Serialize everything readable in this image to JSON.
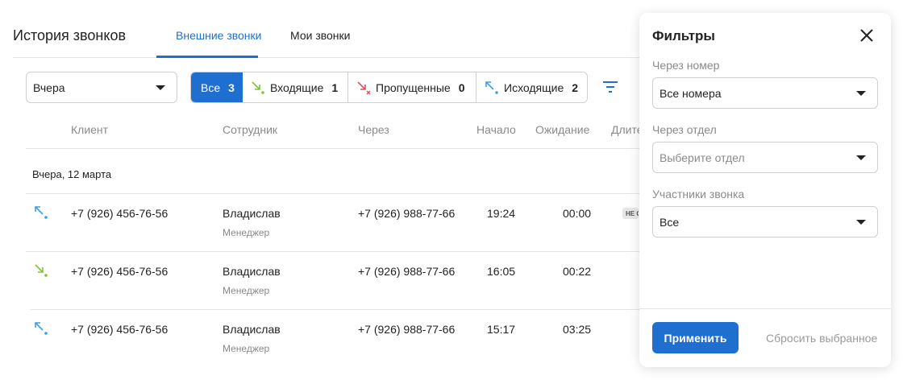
{
  "header": {
    "title": "История звонков",
    "tabs": [
      {
        "label": "Внешние звонки",
        "active": true
      },
      {
        "label": "Мои звонки",
        "active": false
      }
    ]
  },
  "toolbar": {
    "date_select": "Вчера",
    "segments": [
      {
        "label": "Все",
        "count": "3",
        "active": true,
        "icon": "none"
      },
      {
        "label": "Входящие",
        "count": "1",
        "active": false,
        "icon": "incoming-call-icon"
      },
      {
        "label": "Пропущенные",
        "count": "0",
        "active": false,
        "icon": "missed-call-icon"
      },
      {
        "label": "Исходящие",
        "count": "2",
        "active": false,
        "icon": "outgoing-call-icon"
      }
    ],
    "filter_icon": "filter-icon"
  },
  "table": {
    "columns": [
      "Клиент",
      "Сотрудник",
      "Через",
      "Начало",
      "Ожидание",
      "Длите"
    ],
    "group_label": "Вчера, 12 марта",
    "rows": [
      {
        "direction": "outgoing",
        "client": "+7 (926) 456-76-56",
        "employee": "Владислав",
        "role": "Менеджер",
        "via": "+7 (926) 988-77-66",
        "start": "19:24",
        "wait": "00:00",
        "badge": "НЕ О"
      },
      {
        "direction": "incoming",
        "client": "+7 (926) 456-76-56",
        "employee": "Владислав",
        "role": "Менеджер",
        "via": "+7 (926) 988-77-66",
        "start": "16:05",
        "wait": "00:22"
      },
      {
        "direction": "outgoing",
        "client": "+7 (926) 456-76-56",
        "employee": "Владислав",
        "role": "Менеджер",
        "via": "+7 (926) 988-77-66",
        "start": "15:17",
        "wait": "03:25"
      }
    ]
  },
  "filters": {
    "title": "Фильтры",
    "number_label": "Через номер",
    "number_value": "Все номера",
    "department_label": "Через отдел",
    "department_placeholder": "Выберите отдел",
    "participants_label": "Участники звонка",
    "participants_value": "Все",
    "apply_label": "Применить",
    "reset_label": "Сбросить выбранное"
  },
  "colors": {
    "accent": "#1f6fd1",
    "incoming": "#7cc23b",
    "missed": "#e8485f",
    "outgoing": "#3a9ee8"
  }
}
